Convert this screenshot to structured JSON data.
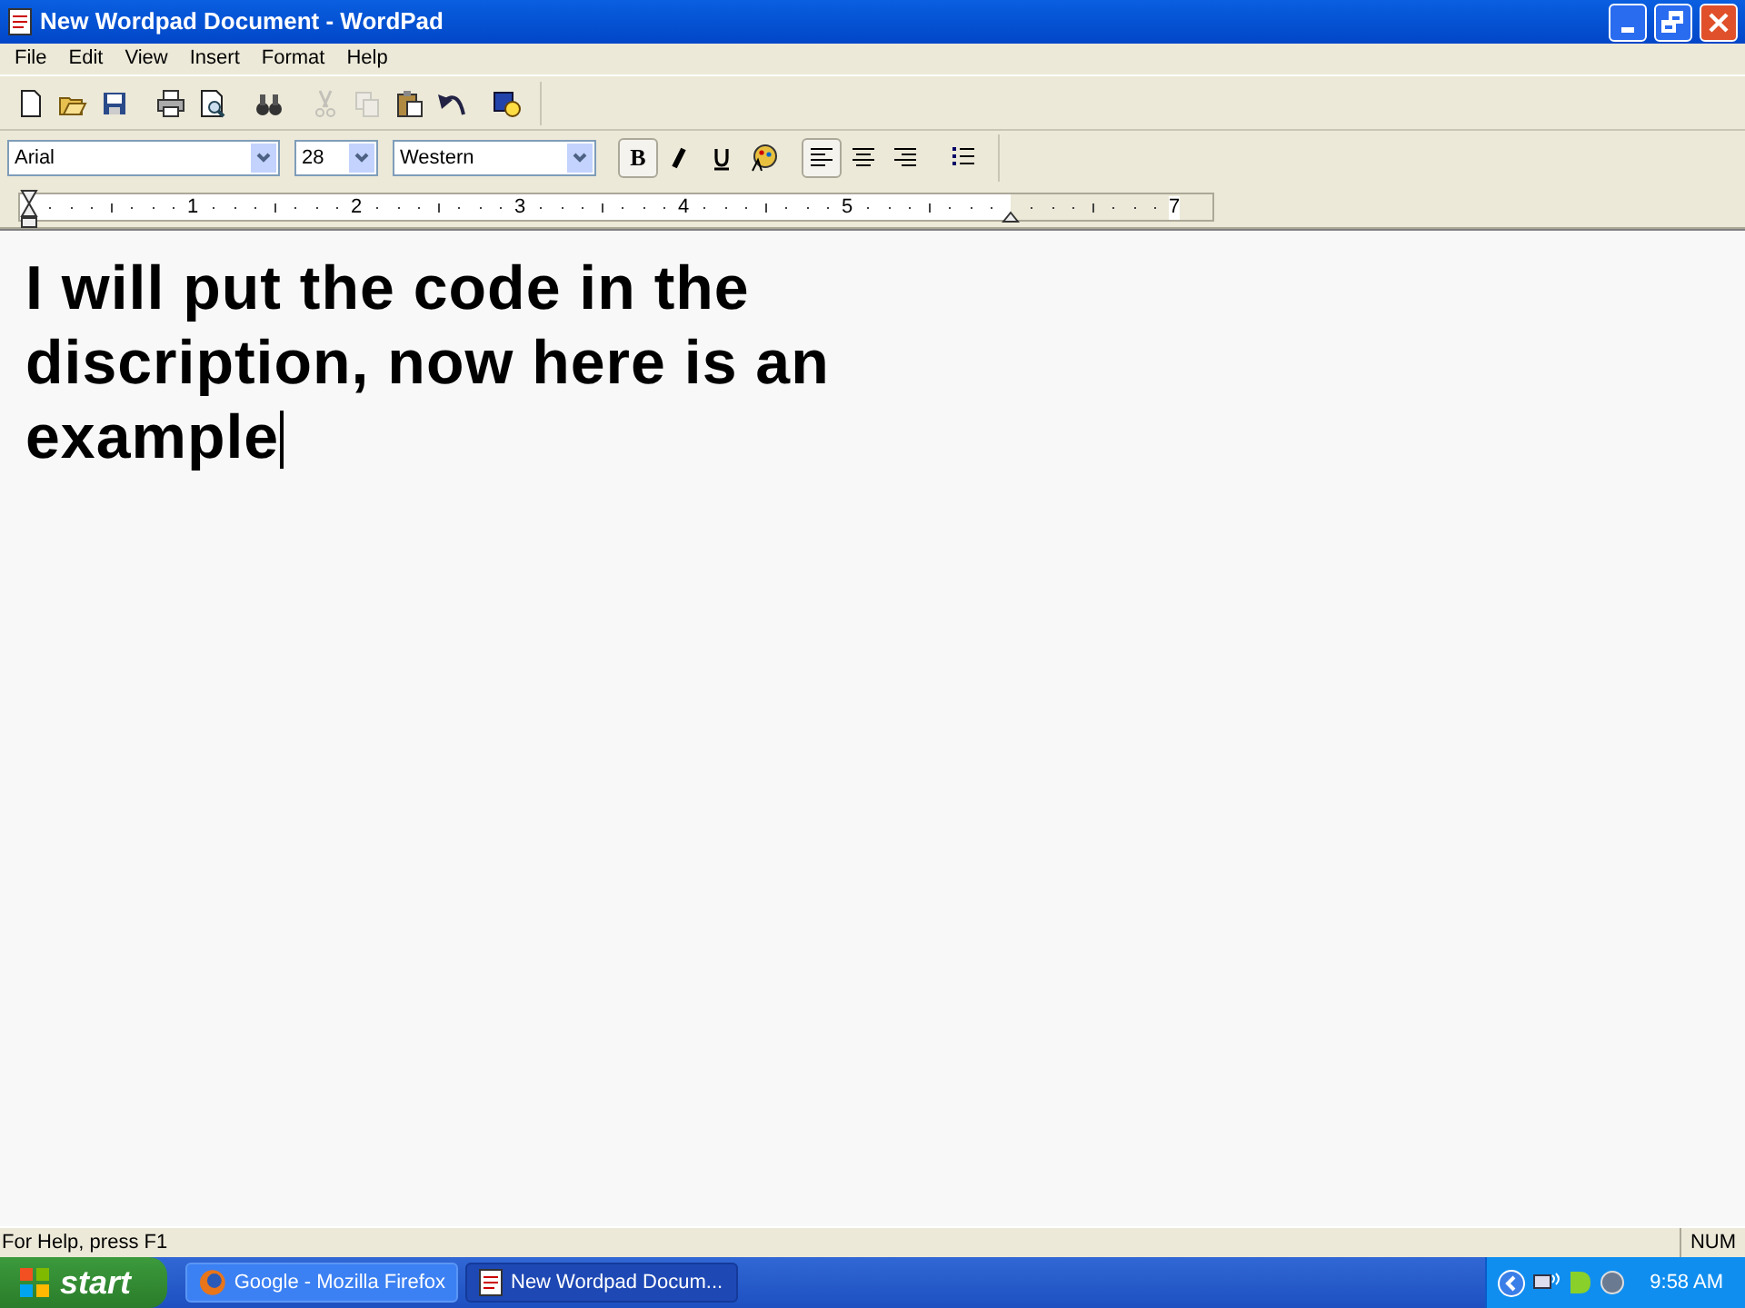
{
  "window": {
    "title": "New Wordpad Document - WordPad"
  },
  "menu": [
    "File",
    "Edit",
    "View",
    "Insert",
    "Format",
    "Help"
  ],
  "toolbar": [
    {
      "kind": "new",
      "disabled": false
    },
    {
      "kind": "open",
      "disabled": false
    },
    {
      "kind": "save",
      "disabled": false
    },
    {
      "kind": "sep"
    },
    {
      "kind": "print",
      "disabled": false
    },
    {
      "kind": "preview",
      "disabled": false
    },
    {
      "kind": "sep"
    },
    {
      "kind": "find",
      "disabled": false
    },
    {
      "kind": "sep"
    },
    {
      "kind": "cut",
      "disabled": true
    },
    {
      "kind": "copy",
      "disabled": true
    },
    {
      "kind": "paste",
      "disabled": false
    },
    {
      "kind": "undo",
      "disabled": false
    },
    {
      "kind": "sep"
    },
    {
      "kind": "datetime",
      "disabled": false
    }
  ],
  "format_bar": {
    "font": "Arial",
    "size": "28",
    "script": "Western",
    "buttons": [
      {
        "kind": "bold",
        "label": "B",
        "selected": true
      },
      {
        "kind": "italic",
        "selected": false
      },
      {
        "kind": "underline",
        "selected": false
      },
      {
        "kind": "color",
        "selected": false
      },
      {
        "kind": "sep"
      },
      {
        "kind": "align-left",
        "selected": true
      },
      {
        "kind": "align-center",
        "selected": false
      },
      {
        "kind": "align-right",
        "selected": false
      },
      {
        "kind": "sep"
      },
      {
        "kind": "bullets",
        "selected": false
      }
    ]
  },
  "ruler": [
    "1",
    "2",
    "3",
    "4",
    "5",
    "7"
  ],
  "document": {
    "lines": [
      "I will put the code in the",
      "discription, now here is an",
      "example"
    ]
  },
  "status_bar": {
    "help": "For Help, press F1",
    "num": "NUM"
  },
  "taskbar": {
    "start": "start",
    "tasks": [
      {
        "label": "Google - Mozilla Firefox",
        "kind": "firefox",
        "selected": false
      },
      {
        "label": "New Wordpad Docum...",
        "kind": "wordpad",
        "selected": true
      }
    ],
    "clock": "9:58 AM"
  }
}
